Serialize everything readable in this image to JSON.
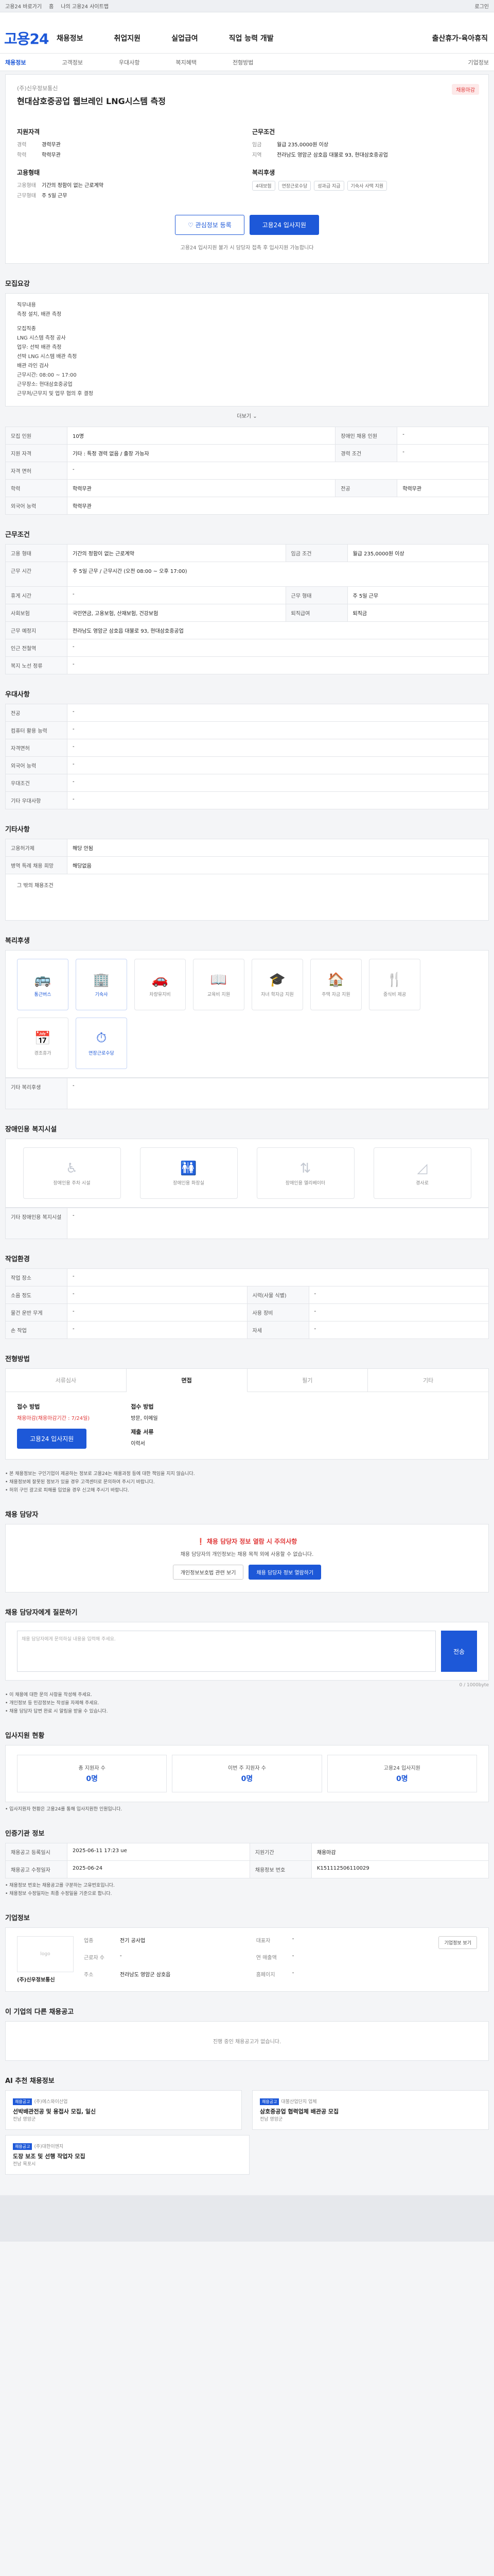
{
  "top": {
    "links": [
      "고용24 바로가기",
      "홈",
      "나의 고용24 사이트맵"
    ],
    "right": "로그인"
  },
  "header": {
    "logo": "고용24",
    "nav": [
      "채용정보",
      "취업지원",
      "실업급여",
      "직업 능력 개발",
      "출산휴가·육아휴직"
    ]
  },
  "subnav": {
    "items": [
      "채용정보",
      "고객정보",
      "우대사항",
      "복지혜택",
      "전형방법",
      "기업정보"
    ]
  },
  "job": {
    "company": "(주)신우정보통신",
    "title": "현대삼호중공업 웹브레인 LNG시스템 측정",
    "badge": "채용마감",
    "left_title": "지원자격",
    "right_title": "근무조건",
    "rows_left": [
      {
        "k": "경력",
        "v": "경력무관"
      },
      {
        "k": "학력",
        "v": "학력무관"
      }
    ],
    "rows_right": [
      {
        "k": "임금",
        "v": "월급 235,0000원 이상"
      },
      {
        "k": "지역",
        "v": "전라남도 영암군 삼호읍 대불로 93, 현대삼호중공업"
      }
    ],
    "left2_title": "고용형태",
    "rows_left2": [
      {
        "k": "고용형태",
        "v": "기간의 정함이 없는 근로계약"
      },
      {
        "k": "근무형태",
        "v": "주 5일 근무"
      }
    ],
    "right2_title": "복리후생",
    "chips": [
      "4대보험",
      "연장근로수당",
      "성과급 지급",
      "기숙사 사택 지원"
    ],
    "btn_interest": "관심정보 등록",
    "btn_apply": "고용24 입사지원",
    "note": "고용24 입사지원 불가 시 담당자 접촉 후 입사지원 가능합니다"
  },
  "duties": {
    "title": "모집요강",
    "lines": [
      "직무내용",
      "측정 설치, 배관 측정",
      "",
      "모집직종",
      "LNG 시스템 측정 공사",
      "업무: 선박 배관 측정",
      "선박 LNG 시스템 배관 측정",
      "배관 라인 검사",
      "근무시간: 08:00 ~ 17:00",
      "근무장소: 현대삼호중공업",
      "근무처/근무지 및 업무 협의 후 결정"
    ],
    "more": "더보기",
    "table": [
      [
        "모집 인원",
        "10명",
        "장애인 채용 인원",
        "-"
      ],
      [
        "지원 자격",
        "기타 : 특정 경력 없음 / 출장 가능자",
        "경력 조건",
        "-"
      ],
      [
        "자격 면허",
        "-",
        "",
        ""
      ],
      [
        "학력",
        "학력무관",
        "전공",
        "학력무관"
      ],
      [
        "외국어 능력",
        "학력무관",
        "",
        ""
      ]
    ]
  },
  "work": {
    "title": "근무조건",
    "table": [
      [
        "고용 형태",
        "기간의 정함이 없는 근로계약",
        "임금 조건",
        "월급 235,0000원 이상"
      ],
      [
        "근무 시간",
        "주 5일 근무 / 근무시간 (오전 08:00 ~ 오후 17:00)",
        "",
        ""
      ],
      [
        "휴게 시간",
        "-",
        "근무 형태",
        "주 5일 근무"
      ],
      [
        "사회보험",
        "국민연금, 고용보험, 산재보험, 건강보험",
        "퇴직급여",
        "퇴직금"
      ],
      [
        "근무 예정지",
        "전라남도 영암군 삼호읍 대불로 93, 현대삼호중공업",
        "",
        ""
      ],
      [
        "인근 전철역",
        "-",
        "",
        ""
      ],
      [
        "복지 노선 정류",
        "-",
        "",
        ""
      ]
    ]
  },
  "preference": {
    "title": "우대사항",
    "table": [
      [
        "전공",
        "-"
      ],
      [
        "컴퓨터 활용 능력",
        "-"
      ],
      [
        "자격면허",
        "-"
      ],
      [
        "외국어 능력",
        "-"
      ],
      [
        "우대조건",
        "-"
      ],
      [
        "기타 우대사항",
        "-"
      ]
    ]
  },
  "etc": {
    "title": "기타사항",
    "table": [
      [
        "고용허가제",
        "해당 안됨"
      ],
      [
        "병역 특례 채용 희망",
        "해당없음"
      ]
    ],
    "extra": "그 밖의 채용조건"
  },
  "welfare": {
    "title": "복리후생",
    "items": [
      {
        "label": "통근버스",
        "icon": "bus-icon",
        "on": true
      },
      {
        "label": "기숙사",
        "icon": "dorm-icon",
        "on": true
      },
      {
        "label": "차량유지비",
        "icon": "car-icon",
        "on": false
      },
      {
        "label": "교육비 지원",
        "icon": "edu-icon",
        "on": false
      },
      {
        "label": "자녀 학자금 지원",
        "icon": "grad-icon",
        "on": false
      },
      {
        "label": "주택 자금 지원",
        "icon": "house-icon",
        "on": false
      },
      {
        "label": "중식비 제공",
        "icon": "meal-icon",
        "on": false
      },
      {
        "label": "경조휴가",
        "icon": "calendar-icon",
        "on": false
      },
      {
        "label": "연장근로수당",
        "icon": "clock-icon",
        "on": true
      }
    ],
    "extra_title": "기타 복리후생",
    "extra_val": "-"
  },
  "disabled": {
    "title": "장애인용 복지시설",
    "items": [
      "장애인용 주차 시설",
      "장애인용 화장실",
      "장애인용 엘리베이터",
      "경사로"
    ],
    "extra_title": "기타 장애인용 복지시설",
    "extra_val": "-"
  },
  "env": {
    "title": "작업환경",
    "table": [
      [
        "작업 장소",
        "-",
        "",
        ""
      ],
      [
        "소음 정도",
        "-",
        "시력(사물 식별)",
        "-"
      ],
      [
        "물건 운반 무게",
        "-",
        "사용 장비",
        "-"
      ],
      [
        "손 작업",
        "-",
        "자세",
        "-"
      ]
    ]
  },
  "process": {
    "title": "전형방법",
    "tabs": [
      "서류심사",
      "면접",
      "필기",
      "기타"
    ],
    "method_label": "접수 방법",
    "method_val": "채용마감(채용마감기간 : 7/24일)",
    "doc_label": "접수 방법",
    "doc_val": "방문, 이메일",
    "deadline_label": "제출 서류",
    "deadline_val": "이력서",
    "apply_btn": "고용24 입사지원",
    "bullets": [
      "• 본 채용정보는 구인기업이 제공하는 정보로 고용24는 채용과정 등에 대한 책임을 지지 않습니다.",
      "• 채용정보에 잘못된 정보가 있을 경우 고객센터로 문의하여 주시기 바랍니다.",
      "• 허위 구인 광고로 피해를 입었을 경우 신고해 주시기 바랍니다."
    ]
  },
  "contact": {
    "title": "채용 담당자",
    "warn": "채용 담당자 정보 열람 시 주의사항",
    "text": "채용 담당자의 개인정보는 채용 목적 외에 사용할 수 없습니다.",
    "btn1": "개인정보보호법 관련 보기",
    "btn2": "채용 담당자 정보 열람하기"
  },
  "inquiry": {
    "title": "채용 담당자에게 질문하기",
    "placeholder": "채용 담당자에게 문의하실 내용을 입력해 주세요.",
    "send": "전송",
    "counter": "0 / 1000byte",
    "notes": [
      "• 이 채용에 대한 문의 사항을 작성해 주세요.",
      "• 개인정보 등 민감정보는 작성을 자제해 주세요.",
      "• 채용 담당자 답변 완료 시 알림을 받을 수 있습니다."
    ]
  },
  "applicants": {
    "title": "입사지원 현황",
    "stats": [
      {
        "label": "총 지원자 수",
        "n": "0명"
      },
      {
        "label": "이번 주 지원자 수",
        "n": "0명"
      },
      {
        "label": "고용24 입사지원",
        "n": "0명"
      }
    ],
    "note": "• 입사지원자 현황은 고용24를 통해 입사지원한 인원입니다."
  },
  "manage": {
    "title": "인증기관 정보",
    "row1": [
      "채용공고 등록일시",
      "2025-06-11 17:23 ue",
      "지원기간",
      "채용마감"
    ],
    "row2": [
      "채용공고 수정일자",
      "2025-06-24",
      "채용정보 번호",
      "K151112506110029"
    ],
    "notes": [
      "• 채용정보 번호는 채용공고를 구분하는 고유번호입니다.",
      "• 채용정보 수정일자는 최종 수정일을 기준으로 합니다."
    ]
  },
  "company_info": {
    "title": "기업정보",
    "logo": "logo",
    "name": "(주)신우정보통신",
    "fields": [
      [
        "업종",
        "전기 공사업"
      ],
      [
        "대표자",
        "-"
      ],
      [
        "근로자 수",
        "-"
      ],
      [
        "연 매출액",
        "-"
      ],
      [
        "주소",
        "전라남도 영암군 삼호읍"
      ],
      [
        "홈페이지",
        "-"
      ]
    ],
    "btn": "기업정보 보기"
  },
  "others": {
    "title": "이 기업의 다른 채용공고",
    "empty": "진행 중인 채용공고가 없습니다."
  },
  "recos": {
    "title": "AI 추천 채용정보",
    "items": [
      {
        "tag": "채용공고",
        "co": "(주)에스와이산업",
        "title": "선박배관전공 및 용접사 모집, 일신",
        "loc": "전남 영암군"
      },
      {
        "tag": "채용공고",
        "co": "대불산업단지 업체",
        "title": "삼호중공업 협력업체 배관공 모집",
        "loc": "전남 영암군"
      },
      {
        "tag": "채용공고",
        "co": "(주)대한이엔지",
        "title": "도장 보조 및 선행 작업자 모집",
        "loc": "전남 목포시"
      }
    ]
  },
  "colors": {
    "accent": "#1d58d8",
    "danger": "#e03838"
  }
}
